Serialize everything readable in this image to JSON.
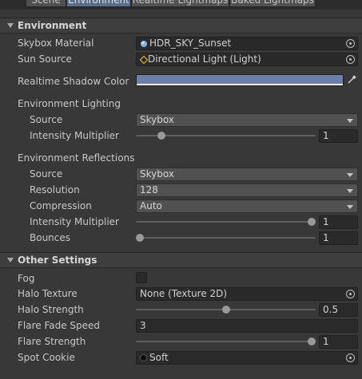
{
  "tabs": [
    {
      "label": "Scene"
    },
    {
      "label": "Environment"
    },
    {
      "label": "Realtime Lightmaps"
    },
    {
      "label": "Baked Lightmaps"
    }
  ],
  "environment": {
    "title": "Environment",
    "skybox_material": {
      "label": "Skybox Material",
      "value": "HDR_SKY_Sunset",
      "icon": "material-sphere-icon"
    },
    "sun_source": {
      "label": "Sun Source",
      "value": "Directional Light (Light)",
      "icon": "light-icon"
    },
    "realtime_shadow_color": {
      "label": "Realtime Shadow Color",
      "color": "#6b7fa8"
    },
    "environment_lighting": {
      "heading": "Environment Lighting",
      "source": {
        "label": "Source",
        "value": "Skybox"
      },
      "intensity_multiplier": {
        "label": "Intensity Multiplier",
        "value": "1",
        "slider_fraction": 0.125
      }
    },
    "environment_reflections": {
      "heading": "Environment Reflections",
      "source": {
        "label": "Source",
        "value": "Skybox"
      },
      "resolution": {
        "label": "Resolution",
        "value": "128"
      },
      "compression": {
        "label": "Compression",
        "value": "Auto"
      },
      "intensity_multiplier": {
        "label": "Intensity Multiplier",
        "value": "1",
        "slider_fraction": 1.0
      },
      "bounces": {
        "label": "Bounces",
        "value": "1",
        "slider_fraction": 0.0
      }
    }
  },
  "other_settings": {
    "title": "Other Settings",
    "fog": {
      "label": "Fog",
      "checked": false
    },
    "halo_texture": {
      "label": "Halo Texture",
      "value": "None (Texture 2D)"
    },
    "halo_strength": {
      "label": "Halo Strength",
      "value": "0.5",
      "slider_fraction": 0.5
    },
    "flare_fade_speed": {
      "label": "Flare Fade Speed",
      "value": "3"
    },
    "flare_strength": {
      "label": "Flare Strength",
      "value": "1",
      "slider_fraction": 1.0
    },
    "spot_cookie": {
      "label": "Spot Cookie",
      "value": "Soft",
      "icon": "texture-icon"
    }
  }
}
